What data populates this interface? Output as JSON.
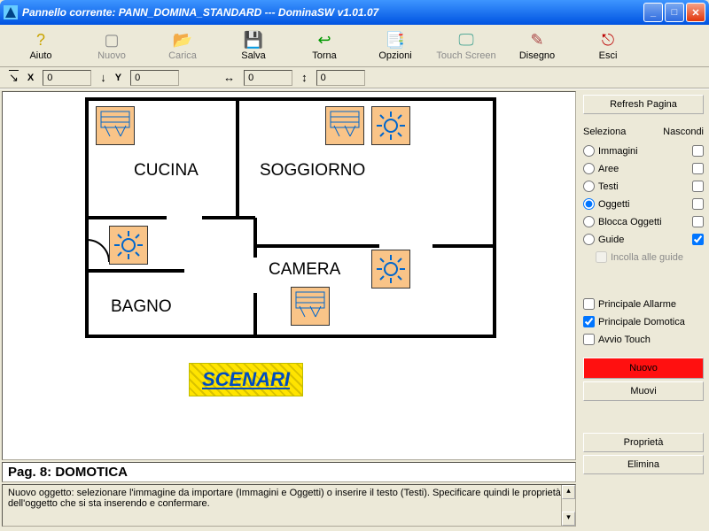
{
  "window": {
    "title": "Pannello corrente:   PANN_DOMINA_STANDARD   ---   DominaSW v1.01.07"
  },
  "toolbar": {
    "aiuto": "Aiuto",
    "nuovo": "Nuovo",
    "carica": "Carica",
    "salva": "Salva",
    "torna": "Torna",
    "opzioni": "Opzioni",
    "touchscreen": "Touch Screen",
    "disegno": "Disegno",
    "esci": "Esci"
  },
  "coords": {
    "x_label": "X",
    "y_label": "Y",
    "x": "0",
    "y": "0",
    "w": "0",
    "h": "0"
  },
  "rooms": {
    "cucina": "CUCINA",
    "soggiorno": "SOGGIORNO",
    "camera": "CAMERA",
    "bagno": "BAGNO"
  },
  "scenari": "SCENARI",
  "page": "Pag.  8:      DOMOTICA",
  "hint": "Nuovo oggetto: selezionare l'immagine da importare (Immagini e Oggetti) o inserire il testo (Testi). Specificare quindi le proprietà dell'oggetto che si sta inserendo e confermare.",
  "sidebar": {
    "refresh": "Refresh Pagina",
    "seleziona": "Seleziona",
    "nascondi": "Nascondi",
    "radios": {
      "immagini": "Immagini",
      "aree": "Aree",
      "testi": "Testi",
      "oggetti": "Oggetti",
      "blocca": "Blocca Oggetti",
      "guide": "Guide"
    },
    "incolla": "Incolla alle guide",
    "principale_allarme": "Principale Allarme",
    "principale_domotica": "Principale Domotica",
    "avvio_touch": "Avvio Touch",
    "nuovo": "Nuovo",
    "muovi": "Muovi",
    "proprieta": "Proprietà",
    "elimina": "Elimina"
  }
}
